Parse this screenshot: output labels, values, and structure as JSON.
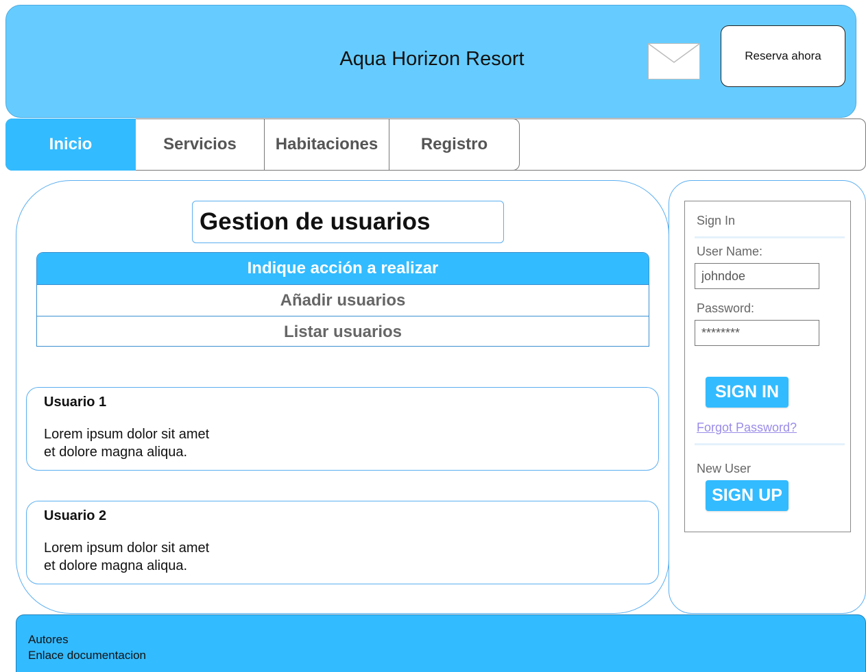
{
  "header": {
    "title": "Aqua Horizon Resort",
    "mail_icon": "mail-icon",
    "reserve_label": "Reserva ahora"
  },
  "nav": {
    "tabs": [
      {
        "label": "Inicio",
        "active": true
      },
      {
        "label": "Servicios",
        "active": false
      },
      {
        "label": "Habitaciones",
        "active": false
      },
      {
        "label": "Registro",
        "active": false
      }
    ]
  },
  "main": {
    "title": "Gestion de usuarios",
    "action_menu": {
      "header": "Indique acción a realizar",
      "items": [
        "Añadir usuarios",
        "Listar usuarios"
      ]
    },
    "users": [
      {
        "name": "Usuario 1",
        "desc_line1": "Lorem ipsum dolor sit amet",
        "desc_line2": "et dolore magna aliqua."
      },
      {
        "name": "Usuario 2",
        "desc_line1": "Lorem ipsum dolor sit amet",
        "desc_line2": "et dolore magna aliqua."
      }
    ]
  },
  "login": {
    "heading": "Sign In",
    "username_label": "User Name:",
    "username_value": "johndoe",
    "password_label": "Password:",
    "password_value": "********",
    "sign_in_label": "SIGN IN",
    "forgot_label": "Forgot Password?",
    "new_user_label": "New User",
    "sign_up_label": "SIGN UP"
  },
  "footer": {
    "line1": "Autores",
    "line2": "Enlace documentacion"
  },
  "colors": {
    "header_bg": "#66ccff",
    "accent": "#33bbff",
    "border_blue": "#5aaef0",
    "link": "#9a8ce8"
  }
}
